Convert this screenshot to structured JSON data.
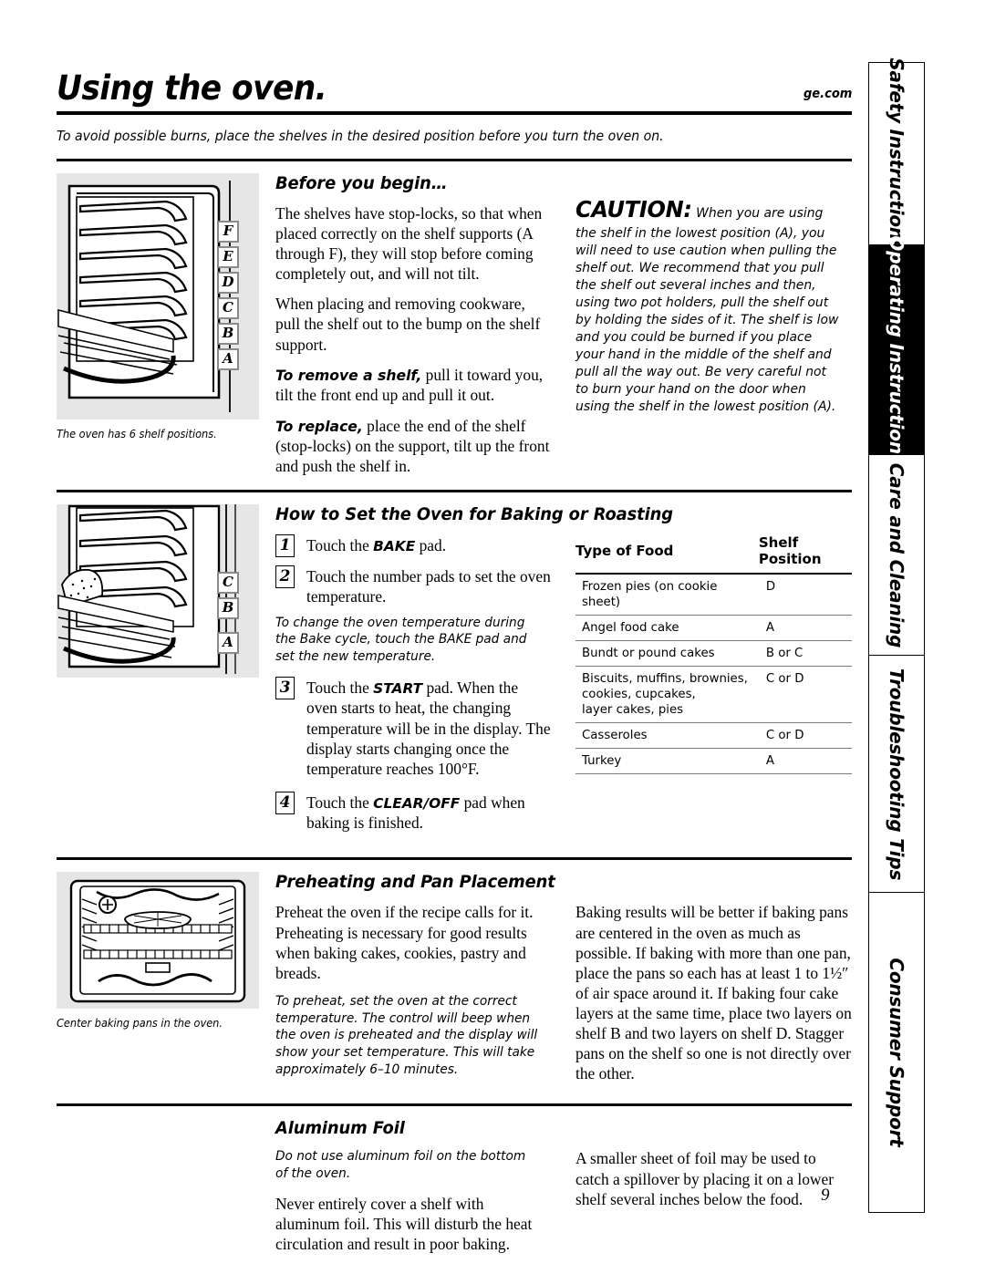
{
  "header": {
    "title": "Using the oven.",
    "url": "ge.com",
    "intro": "To avoid possible burns, place the shelves in the desired position before you turn the oven on."
  },
  "page_number": "9",
  "sidebar": {
    "tabs": [
      {
        "label": "Safety Instructions",
        "active": false
      },
      {
        "label": "Operating Instructions",
        "active": true
      },
      {
        "label": "Care and Cleaning",
        "active": false
      },
      {
        "label": "Troubleshooting Tips",
        "active": false
      },
      {
        "label": "Consumer Support",
        "active": false
      }
    ]
  },
  "figures": {
    "shelf_positions": {
      "caption": "The oven has 6 shelf positions.",
      "labels": [
        "F",
        "E",
        "D",
        "C",
        "B",
        "A"
      ]
    },
    "shelf_lower": {
      "labels": [
        "C",
        "B",
        "A"
      ]
    },
    "center_pans": {
      "caption": "Center baking pans in the oven."
    }
  },
  "before_you_begin": {
    "heading": "Before you begin…",
    "p1": "The shelves have stop-locks, so that when placed correctly on the shelf supports (A through F), they will stop before coming completely out, and will not tilt.",
    "p2": "When placing and removing cookware, pull the shelf out to the bump on the shelf support.",
    "p3_lead": "To remove a shelf,",
    "p3": " pull it toward you, tilt the front end up and pull it out.",
    "p4_lead": "To replace,",
    "p4": " place the end of the shelf (stop-locks) on the support, tilt up the front and push the shelf in.",
    "caution_word": "CAUTION:",
    "caution_text": " When you are using the shelf in the lowest position (A), you will need to use caution when pulling the shelf out. We recommend that you pull the shelf out several inches and then, using two pot holders, pull the shelf out by holding the sides of it. The shelf is low and you could be burned if you place your hand in the middle of the shelf and pull all the way out. Be very careful not to burn your hand on the door when using the shelf in the lowest position (A)."
  },
  "baking": {
    "heading": "How to Set the Oven for Baking or Roasting",
    "steps": [
      {
        "num": "1",
        "pre": "Touch the ",
        "pad": "BAKE",
        "post": " pad."
      },
      {
        "num": "2",
        "pre": "Touch the number pads to set the oven temperature.",
        "pad": "",
        "post": ""
      },
      {
        "num": "3",
        "pre": "Touch the ",
        "pad": "START",
        "post": " pad. When the oven starts to heat, the changing temperature will be in the display. The display starts changing once the temperature reaches 100°F."
      },
      {
        "num": "4",
        "pre": "Touch the ",
        "pad": "CLEAR/OFF",
        "post": " pad when baking is finished."
      }
    ],
    "note": "To change the oven temperature during the Bake cycle, touch the BAKE pad and set the new temperature.",
    "table": {
      "columns": [
        "Type of Food",
        "Shelf Position"
      ],
      "rows": [
        {
          "food": "Frozen pies (on cookie sheet)",
          "position": "D"
        },
        {
          "food": "Angel food cake",
          "position": "A"
        },
        {
          "food": "Bundt or pound cakes",
          "position": "B or C"
        },
        {
          "food": "Biscuits, muffins, brownies,\ncookies, cupcakes,\nlayer cakes, pies",
          "position": "C or D"
        },
        {
          "food": "Casseroles",
          "position": "C or D"
        },
        {
          "food": "Turkey",
          "position": "A"
        }
      ]
    }
  },
  "preheating": {
    "heading": "Preheating and Pan Placement",
    "p1": "Preheat the oven if the recipe calls for it. Preheating is necessary for good results when baking cakes, cookies, pastry and breads.",
    "note": "To preheat, set the oven at the correct temperature. The control will beep when the oven is preheated and the display will show your set temperature. This will take approximately 6–10 minutes.",
    "p2": "Baking results will be better if baking pans are centered in the oven as much as possible. If baking with more than one pan, place the pans so each has at least 1 to 1½″ of air space around it. If baking four cake layers at the same time, place two layers on shelf B and two layers on shelf D. Stagger pans on the shelf so one is not directly over the other."
  },
  "aluminum_foil": {
    "heading": "Aluminum Foil",
    "note": "Do not use aluminum foil on the bottom of the oven.",
    "p1": "Never entirely cover a shelf with aluminum foil. This will disturb the heat circulation and result in poor baking.",
    "p2": "A smaller sheet of foil may be used to catch a spillover by placing it on a lower shelf several inches below the food."
  }
}
